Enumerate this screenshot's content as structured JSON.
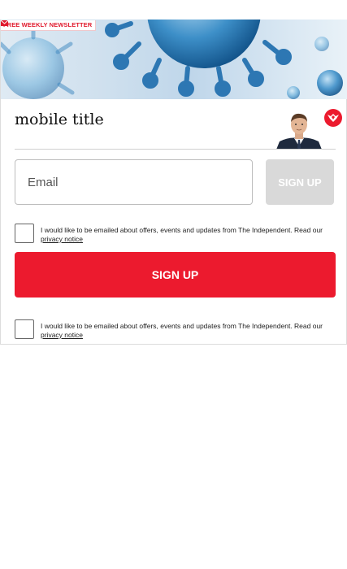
{
  "newsletter": {
    "badge_label": "FREE WEEKLY NEWSLETTER",
    "badge_icon": "mail-icon",
    "title": "mobile title",
    "brand_color": "#ec1a2e"
  },
  "form": {
    "email_placeholder": "Email",
    "email_value": "",
    "signup_small_label": "SIGN UP",
    "signup_large_label": "SIGN UP"
  },
  "consents": [
    {
      "text": "I would like to be emailed about offers, events and updates from The Independent. Read our ",
      "link_text": "privacy notice",
      "checked": false
    },
    {
      "text": "I would like to be emailed about offers, events and updates from The Independent. Read our ",
      "link_text": "privacy notice",
      "checked": false
    }
  ]
}
